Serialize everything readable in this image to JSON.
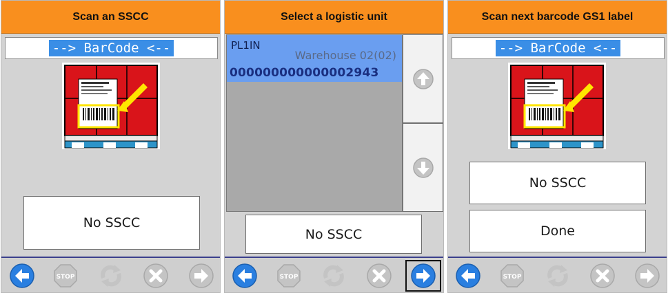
{
  "panels": [
    {
      "title": "Scan an SSCC",
      "scan_placeholder": "--> BarCode <--",
      "buttons": [
        "No SSCC"
      ]
    },
    {
      "title": "Select a logistic unit",
      "list_items": [
        {
          "code": "PL1IN",
          "warehouse": "Warehouse 02(02)",
          "sscc": "000000000000002943"
        }
      ],
      "buttons": [
        "No SSCC"
      ]
    },
    {
      "title": "Scan next barcode GS1 label",
      "scan_placeholder": "--> BarCode <--",
      "buttons": [
        "No SSCC",
        "Done"
      ]
    }
  ],
  "toolbar_icons": [
    "back-arrow-icon",
    "stop-icon",
    "refresh-icon",
    "cancel-icon",
    "forward-arrow-icon"
  ],
  "colors": {
    "header": "#f98f1e",
    "panel_bg": "#d3d3d3",
    "selection": "#6a9ef0",
    "scan_highlight": "#3a8ee6",
    "icon_active": "#2a7fe0",
    "icon_inactive": "#c4c4c4"
  }
}
